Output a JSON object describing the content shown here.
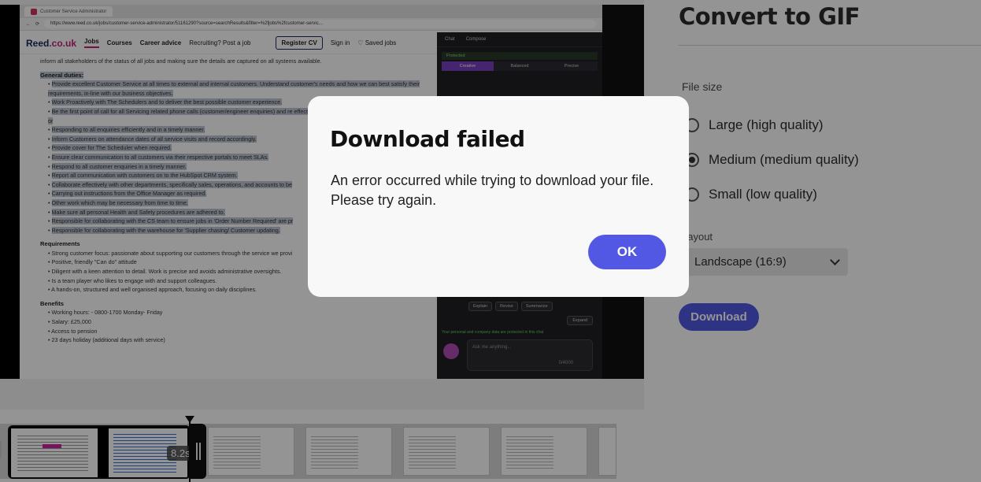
{
  "preview": {
    "browser_tab_title": "Customer Service Administrator",
    "url": "https://www.reed.co.uk/jobs/customer-service-administrator/51161290?source=searchResults&filter=%2fjobs%2fcustomer-servic...",
    "site": {
      "logo_main": "Reed",
      "logo_suffix": ".co.uk",
      "nav": [
        "Jobs",
        "Courses",
        "Career advice"
      ],
      "recruiting": "Recruiting? Post a job",
      "register": "Register CV",
      "sign_in": "Sign in",
      "saved_jobs": "Saved jobs"
    },
    "job": {
      "intro": "inform all stakeholders of the status of all jobs and making sure the details are captured on all systems available.",
      "general_heading": "General duties:",
      "general_items": [
        "Provide excellent Customer Service at all times to external and internal customers. Understand customer's needs and how we can best satisfy their requirements, in-line with our business objectives.",
        "Work Proactively with The Schedulers and to deliver the best possible customer experience.",
        "Be the first point of call for all Servicing related phone calls (customer/engineer enquiries) and re effectively or directing them to the correct department or",
        "Responding to all enquiries efficiently and in a timely manner.",
        "Inform Customers on attendance dates of all service visits and record accordingly.",
        "Provide cover for The Scheduler when required.",
        "Ensure clear communication to all customers via their respective portals to meet SLAs.",
        "Respond to all customer enquiries in a timely manner.",
        "Report all communication with customers on to the HubSpot CRM system.",
        "Collaborate effectively with other departments, specifically sales, operations, and accounts to be",
        "Carrying out instructions from the Office Manager as required.",
        "Other work which may be necessary from time to time.",
        "Make sure all personal Health and Safety procedures are adhered to.",
        "Responsible for collaborating with the CS team to ensure jobs in 'Order Number Required' are pr",
        "Responsible for collaborating with the warehouse for 'Supplier chasing/ Customer updating."
      ],
      "requirements_heading": "Requirements",
      "requirements_items": [
        "Strong customer focus: passionate about supporting our customers through the service we provi",
        "Positive, friendly \"Can do\" attitude",
        "Diligent with a keen attention to detail. Work is precise and avoids administrative oversights.",
        "Is a team player who likes to engage with and support colleagues.",
        "A hands-on, structured and well organised approach, focusing on daily disciplines."
      ],
      "benefits_heading": "Benefits",
      "benefits_items": [
        "Working hours: - 0800-1700 Monday- Friday",
        "Salary: £25,000",
        "Access to pension",
        "23 days holiday (additional days with service)"
      ]
    },
    "copilot": {
      "tab_chat": "Chat",
      "tab_compose": "Compose",
      "protected": "Protected",
      "modes": [
        "Creative",
        "Balanced",
        "Precise"
      ],
      "actions": [
        "Explain",
        "Revise",
        "Summarize"
      ],
      "expand": "Expand",
      "privacy_note": "Your personal and company data are protected in this chat",
      "ask_placeholder": "Ask me anything...",
      "char_count": "0/4000"
    }
  },
  "timeline": {
    "clip_duration": "8.2s"
  },
  "panel": {
    "title": "Convert to GIF",
    "file_size_label": "File size",
    "options": [
      {
        "label": "Large (high quality)",
        "selected": false
      },
      {
        "label": "Medium (medium quality)",
        "selected": true
      },
      {
        "label": "Small (low quality)",
        "selected": false
      }
    ],
    "layout_label": "Layout",
    "layout_value": "Landscape (16:9)",
    "download_label": "Download"
  },
  "modal": {
    "title": "Download failed",
    "message_line1": "An error occurred while trying to download your file.",
    "message_line2": "Please try again.",
    "ok_label": "OK"
  },
  "colors": {
    "accent": "#5258e4",
    "overlay": "rgba(0,0,0,0.42)"
  }
}
